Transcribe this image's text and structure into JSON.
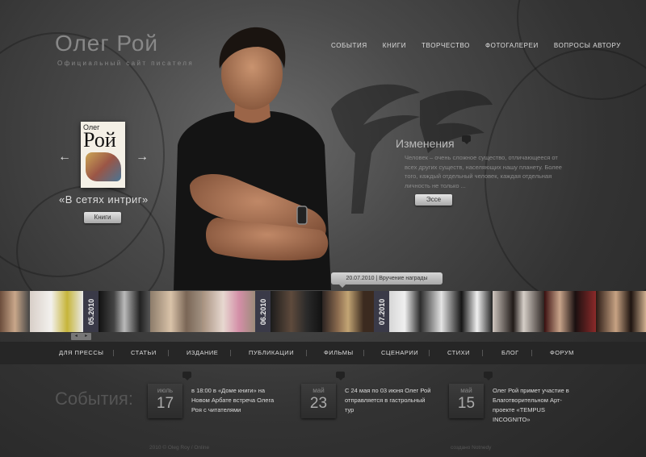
{
  "logo": {
    "title": "Олег Рой",
    "subtitle": "Официальный сайт писателя"
  },
  "topnav": [
    "События",
    "Книги",
    "Творчество",
    "Фотогалереи",
    "Вопросы автору"
  ],
  "book": {
    "cover_author": "Олег",
    "cover_title": "Рой",
    "title": "«В сетях интриг»",
    "button": "Книги"
  },
  "slider": {
    "prev_icon": "←",
    "next_icon": "→"
  },
  "article": {
    "title": "Изменения",
    "text": "Человек – очень сложное существо, отличающееся от всех других существ, населяющих нашу планету. Более того, каждый отдельный человек, каждая отдельная личность не только ...",
    "button": "Эссе"
  },
  "gallery": {
    "tag": "20.07.2010  |  Вручение награды",
    "labels": [
      "05.2010",
      "06.2010",
      "07.2010"
    ],
    "nav_prev": "◂",
    "nav_next": "▸"
  },
  "bottomnav": [
    "Для прессы",
    "Статьи",
    "Издание",
    "Публикации",
    "Фильмы",
    "Сценарии",
    "Стихи",
    "Блог",
    "Форум"
  ],
  "events": {
    "title": "События:",
    "items": [
      {
        "month": "июль",
        "day": "17",
        "text": "в 18:00 в «Доме книги» на Новом Арбате встреча Олега Роя с читателями"
      },
      {
        "month": "май",
        "day": "23",
        "text": "С 24 мая по 03 июня Олег Рой отправляется в гастрольный тур"
      },
      {
        "month": "май",
        "day": "15",
        "text": "Олег Рой примет участие в Благотворительном Арт-проекте «TEMPUS INCOGNITO»"
      }
    ]
  },
  "footer": {
    "left": "2010 © Oleg Roy / Online",
    "right": "создано Notnedy"
  },
  "colors": {
    "background": "#2b2b2b",
    "accent_button": "#c8c8c8",
    "strip_label": "#3a3a48"
  }
}
